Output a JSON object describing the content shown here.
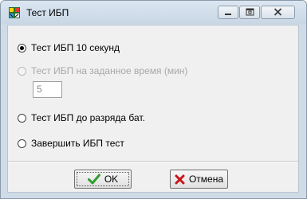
{
  "window": {
    "title": "Тест ИБП",
    "icon": "ups-app-icon"
  },
  "title_controls": {
    "minimize_icon": "minimize-icon",
    "maximize_icon": "maximize-icon",
    "close_icon": "close-icon"
  },
  "options": [
    {
      "label": "Тест ИБП 10 секунд",
      "checked": true,
      "enabled": true
    },
    {
      "label": "Тест ИБП на заданное время (мин)",
      "checked": false,
      "enabled": false
    },
    {
      "label": "Тест ИБП до разряда бат.",
      "checked": false,
      "enabled": true
    },
    {
      "label": "Завершить ИБП тест",
      "checked": false,
      "enabled": true
    }
  ],
  "duration_input": {
    "value": "5",
    "enabled": false
  },
  "buttons": {
    "ok_label": "OK",
    "cancel_label": "Отмена",
    "ok_icon": "check-icon",
    "cancel_icon": "red-x-icon"
  },
  "colors": {
    "check_green": "#2f9e2f",
    "cancel_red": "#c8141b"
  }
}
